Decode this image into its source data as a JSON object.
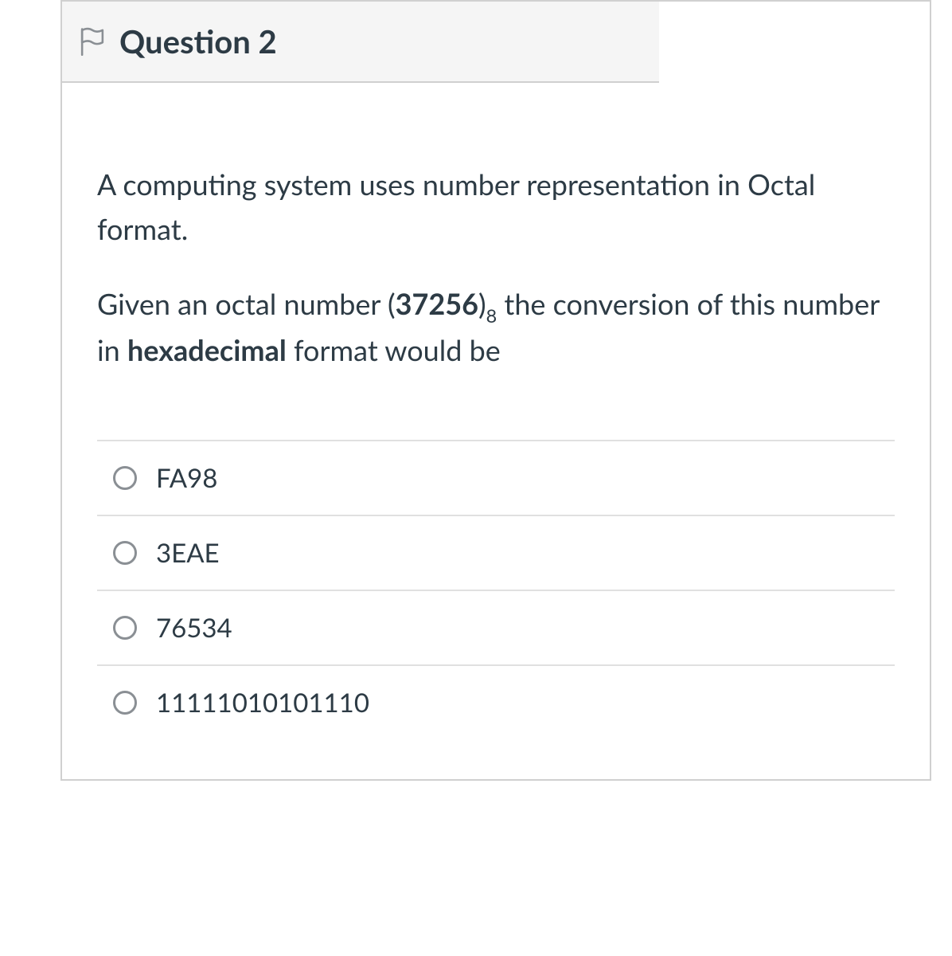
{
  "header": {
    "title": "Question 2"
  },
  "prompt": {
    "p1": "A computing system uses number representation in Octal format.",
    "p2_pre": "Given an octal number (",
    "p2_num": "37256",
    "p2_after_num": ")",
    "p2_sub": "8",
    "p2_mid": " the conversion of this number in ",
    "p2_hex": "hexadecimal",
    "p2_end": " format would be"
  },
  "options": [
    {
      "label": "FA98"
    },
    {
      "label": "3EAE"
    },
    {
      "label": "76534"
    },
    {
      "label": "11111010101110"
    }
  ]
}
